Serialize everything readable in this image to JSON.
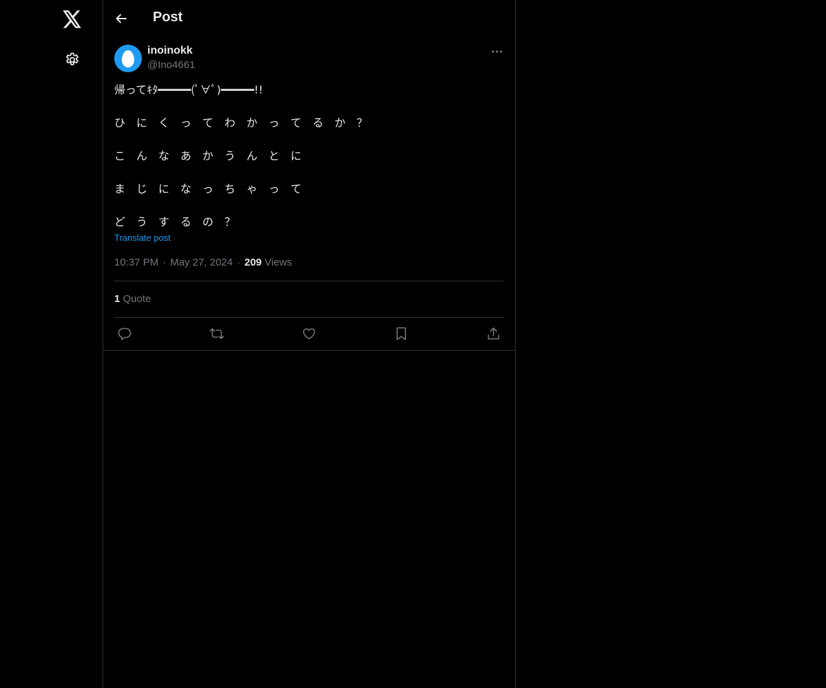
{
  "header": {
    "title": "Post",
    "back_icon": "back-arrow-icon"
  },
  "nav": {
    "logo_icon": "x-logo-icon",
    "settings_icon": "gear-icon"
  },
  "post": {
    "author": {
      "display_name": "inoinokk",
      "handle": "@Ino4661",
      "avatar": "default-egg-avatar"
    },
    "lines": [
      "帰ってｷﾀ━━━━━(ﾟ∀ﾟ)━━━━━!!",
      "ひ　に　く　っ　て　わ　か　っ　て　る　か　？",
      "こ　ん　な　あ　か　う　ん　と　に",
      "ま　じ　に　な　っ　ち　ゃ　っ　て",
      "ど　う　す　る　の　？"
    ],
    "translate_label": "Translate post",
    "time": "10:37 PM",
    "date": "May 27, 2024",
    "separator": "·",
    "views_count": "209",
    "views_label": "Views",
    "quote_count": "1",
    "quote_label": "Quote"
  },
  "actions": [
    {
      "name": "reply",
      "icon": "reply-icon"
    },
    {
      "name": "repost",
      "icon": "repost-icon"
    },
    {
      "name": "like",
      "icon": "heart-icon"
    },
    {
      "name": "bookmark",
      "icon": "bookmark-icon"
    },
    {
      "name": "share",
      "icon": "share-icon"
    }
  ],
  "colors": {
    "background": "#000000",
    "text": "#e7e9ea",
    "secondary_text": "#71767b",
    "accent": "#1d9bf0",
    "border": "#2f3336"
  }
}
